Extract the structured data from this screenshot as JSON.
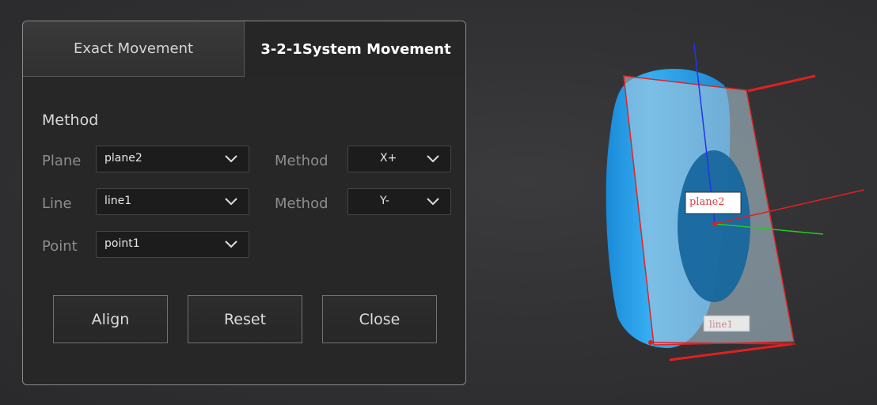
{
  "tabs": [
    {
      "label": "Exact Movement"
    },
    {
      "label": "3-2-1System  Movement"
    }
  ],
  "section": {
    "title": "Method"
  },
  "rows": {
    "plane": {
      "label": "Plane",
      "value": "plane2"
    },
    "line": {
      "label": "Line",
      "value": "line1"
    },
    "point": {
      "label": "Point",
      "value": "point1"
    },
    "method1": {
      "label": "Method",
      "value": "X+"
    },
    "method2": {
      "label": "Method",
      "value": "Y-"
    }
  },
  "buttons": {
    "align": "Align",
    "reset": "Reset",
    "close": "Close"
  },
  "viewport": {
    "plane_label": "plane2",
    "line_label": "line1"
  },
  "icons": [
    "chevron-down-icon"
  ],
  "colors": {
    "accent_blue": "#1e90e6",
    "axis_red": "#e02020",
    "axis_green": "#22cc22",
    "axis_blue": "#2233ee"
  }
}
